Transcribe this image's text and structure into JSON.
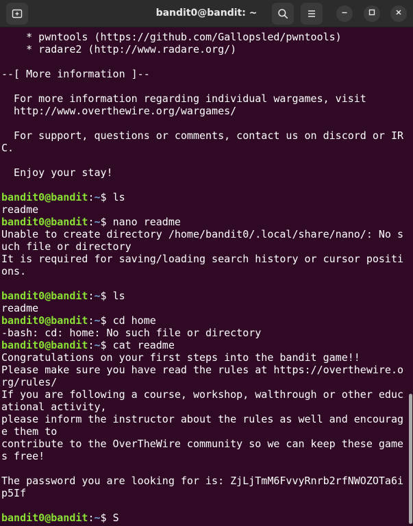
{
  "window": {
    "title": "bandit0@bandit: ~"
  },
  "colors": {
    "background": "#300a24",
    "prompt_user": "#8ae234",
    "prompt_path": "#729fcf",
    "text": "#ffffff"
  },
  "icons": {
    "new_tab": "new-tab-icon",
    "search": "search-icon",
    "menu": "hamburger-menu-icon",
    "minimize": "minimize-icon",
    "maximize": "maximize-icon",
    "close": "close-icon"
  },
  "terminal": {
    "lines": [
      {
        "type": "text",
        "text": "    * pwntools (https://github.com/Gallopsled/pwntools)"
      },
      {
        "type": "text",
        "text": "    * radare2 (http://www.radare.org/)"
      },
      {
        "type": "text",
        "text": ""
      },
      {
        "type": "text",
        "text": "--[ More information ]--"
      },
      {
        "type": "text",
        "text": ""
      },
      {
        "type": "text",
        "text": "  For more information regarding individual wargames, visit"
      },
      {
        "type": "text",
        "text": "  http://www.overthewire.org/wargames/"
      },
      {
        "type": "text",
        "text": ""
      },
      {
        "type": "text",
        "text": "  For support, questions or comments, contact us on discord or IR"
      },
      {
        "type": "text",
        "text": "C."
      },
      {
        "type": "text",
        "text": ""
      },
      {
        "type": "text",
        "text": "  Enjoy your stay!"
      },
      {
        "type": "text",
        "text": ""
      },
      {
        "type": "prompt",
        "user": "bandit0@bandit",
        "sep": ":",
        "path": "~",
        "symbol": "$ ",
        "command": "ls"
      },
      {
        "type": "text",
        "text": "readme"
      },
      {
        "type": "prompt",
        "user": "bandit0@bandit",
        "sep": ":",
        "path": "~",
        "symbol": "$ ",
        "command": "nano readme"
      },
      {
        "type": "text",
        "text": "Unable to create directory /home/bandit0/.local/share/nano/: No s"
      },
      {
        "type": "text",
        "text": "uch file or directory"
      },
      {
        "type": "text",
        "text": "It is required for saving/loading search history or cursor positi"
      },
      {
        "type": "text",
        "text": "ons."
      },
      {
        "type": "text",
        "text": ""
      },
      {
        "type": "prompt",
        "user": "bandit0@bandit",
        "sep": ":",
        "path": "~",
        "symbol": "$ ",
        "command": "ls"
      },
      {
        "type": "text",
        "text": "readme"
      },
      {
        "type": "prompt",
        "user": "bandit0@bandit",
        "sep": ":",
        "path": "~",
        "symbol": "$ ",
        "command": "cd home"
      },
      {
        "type": "text",
        "text": "-bash: cd: home: No such file or directory"
      },
      {
        "type": "prompt",
        "user": "bandit0@bandit",
        "sep": ":",
        "path": "~",
        "symbol": "$ ",
        "command": "cat readme"
      },
      {
        "type": "text",
        "text": "Congratulations on your first steps into the bandit game!!"
      },
      {
        "type": "text",
        "text": "Please make sure you have read the rules at https://overthewire.o"
      },
      {
        "type": "text",
        "text": "rg/rules/"
      },
      {
        "type": "text",
        "text": "If you are following a course, workshop, walthrough or other educ"
      },
      {
        "type": "text",
        "text": "ational activity,"
      },
      {
        "type": "text",
        "text": "please inform the instructor about the rules as well and encourag"
      },
      {
        "type": "text",
        "text": "e them to"
      },
      {
        "type": "text",
        "text": "contribute to the OverTheWire community so we can keep these game"
      },
      {
        "type": "text",
        "text": "s free!"
      },
      {
        "type": "text",
        "text": ""
      },
      {
        "type": "text",
        "text": "The password you are looking for is: ZjLjTmM6FvvyRnrb2rfNWOZOTa6i"
      },
      {
        "type": "text",
        "text": "p5If"
      },
      {
        "type": "text",
        "text": ""
      },
      {
        "type": "prompt",
        "user": "bandit0@bandit",
        "sep": ":",
        "path": "~",
        "symbol": "$ ",
        "command": "S"
      }
    ]
  }
}
